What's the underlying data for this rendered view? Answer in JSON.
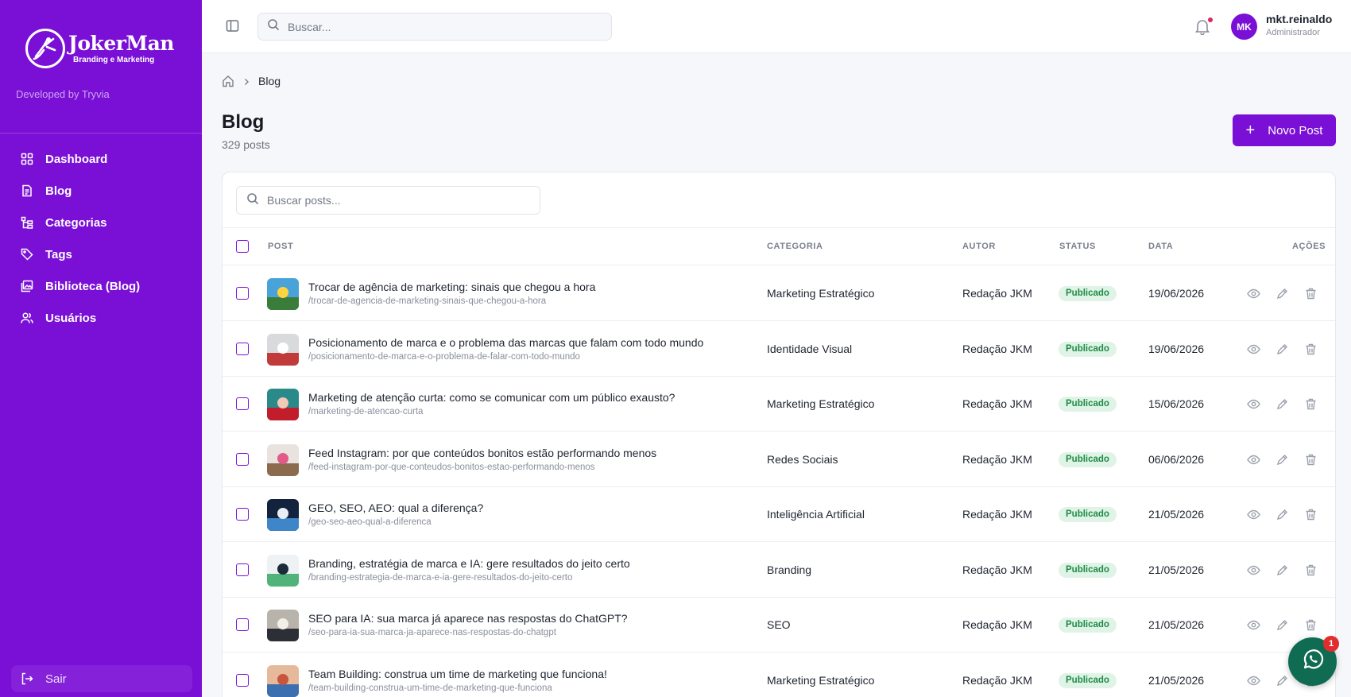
{
  "brand": {
    "logo_word": "JokerMan",
    "logo_sub": "Branding e Marketing",
    "developed_by": "Developed by Tryvia"
  },
  "sidebar": {
    "items": [
      {
        "label": "Dashboard",
        "icon": "grid-icon"
      },
      {
        "label": "Blog",
        "icon": "file-text-icon"
      },
      {
        "label": "Categorias",
        "icon": "list-tree-icon"
      },
      {
        "label": "Tags",
        "icon": "tag-icon"
      },
      {
        "label": "Biblioteca (Blog)",
        "icon": "images-icon"
      },
      {
        "label": "Usuários",
        "icon": "users-icon"
      }
    ],
    "logout_label": "Sair"
  },
  "topbar": {
    "search_placeholder": "Buscar...",
    "user_initials": "MK",
    "user_name": "mkt.reinaldo",
    "user_role": "Administrador"
  },
  "breadcrumb": {
    "current": "Blog"
  },
  "page": {
    "title": "Blog",
    "count": "329 posts",
    "new_button": "Novo Post",
    "search_placeholder": "Buscar posts..."
  },
  "table": {
    "headers": {
      "post": "POST",
      "category": "CATEGORIA",
      "author": "AUTOR",
      "status": "STATUS",
      "date": "DATA",
      "actions": "AÇÕES"
    },
    "rows": [
      {
        "title": "Trocar de agência de marketing: sinais que chegou a hora",
        "slug": "/trocar-de-agencia-de-marketing-sinais-que-chegou-a-hora",
        "category": "Marketing Estratégico",
        "author": "Redação JKM",
        "status": "Publicado",
        "date": "19/06/2026"
      },
      {
        "title": "Posicionamento de marca e o problema das marcas que falam com todo mundo",
        "slug": "/posicionamento-de-marca-e-o-problema-de-falar-com-todo-mundo",
        "category": "Identidade Visual",
        "author": "Redação JKM",
        "status": "Publicado",
        "date": "19/06/2026"
      },
      {
        "title": "Marketing de atenção curta: como se comunicar com um público exausto?",
        "slug": "/marketing-de-atencao-curta",
        "category": "Marketing Estratégico",
        "author": "Redação JKM",
        "status": "Publicado",
        "date": "15/06/2026"
      },
      {
        "title": "Feed Instagram: por que conteúdos bonitos estão performando menos",
        "slug": "/feed-instagram-por-que-conteudos-bonitos-estao-performando-menos",
        "category": "Redes Sociais",
        "author": "Redação JKM",
        "status": "Publicado",
        "date": "06/06/2026"
      },
      {
        "title": "GEO, SEO, AEO: qual a diferença?",
        "slug": "/geo-seo-aeo-qual-a-diferenca",
        "category": "Inteligência Artificial",
        "author": "Redação JKM",
        "status": "Publicado",
        "date": "21/05/2026"
      },
      {
        "title": "Branding, estratégia de marca e IA: gere resultados do jeito certo",
        "slug": "/branding-estrategia-de-marca-e-ia-gere-resultados-do-jeito-certo",
        "category": "Branding",
        "author": "Redação JKM",
        "status": "Publicado",
        "date": "21/05/2026"
      },
      {
        "title": "SEO para IA: sua marca já aparece nas respostas do ChatGPT?",
        "slug": "/seo-para-ia-sua-marca-ja-aparece-nas-respostas-do-chatgpt",
        "category": "SEO",
        "author": "Redação JKM",
        "status": "Publicado",
        "date": "21/05/2026"
      },
      {
        "title": "Team Building: construa um time de marketing que funciona!",
        "slug": "/team-building-construa-um-time-de-marketing-que-funciona",
        "category": "Marketing Estratégico",
        "author": "Redação JKM",
        "status": "Publicado",
        "date": "21/05/2026"
      }
    ]
  },
  "whatsapp": {
    "badge": "1",
    "icon": "whatsapp-icon"
  },
  "colors": {
    "accent": "#7a0fd6",
    "published_bg": "#dff4e6",
    "published_text": "#1e8a45",
    "whatsapp": "#0f6b52"
  }
}
